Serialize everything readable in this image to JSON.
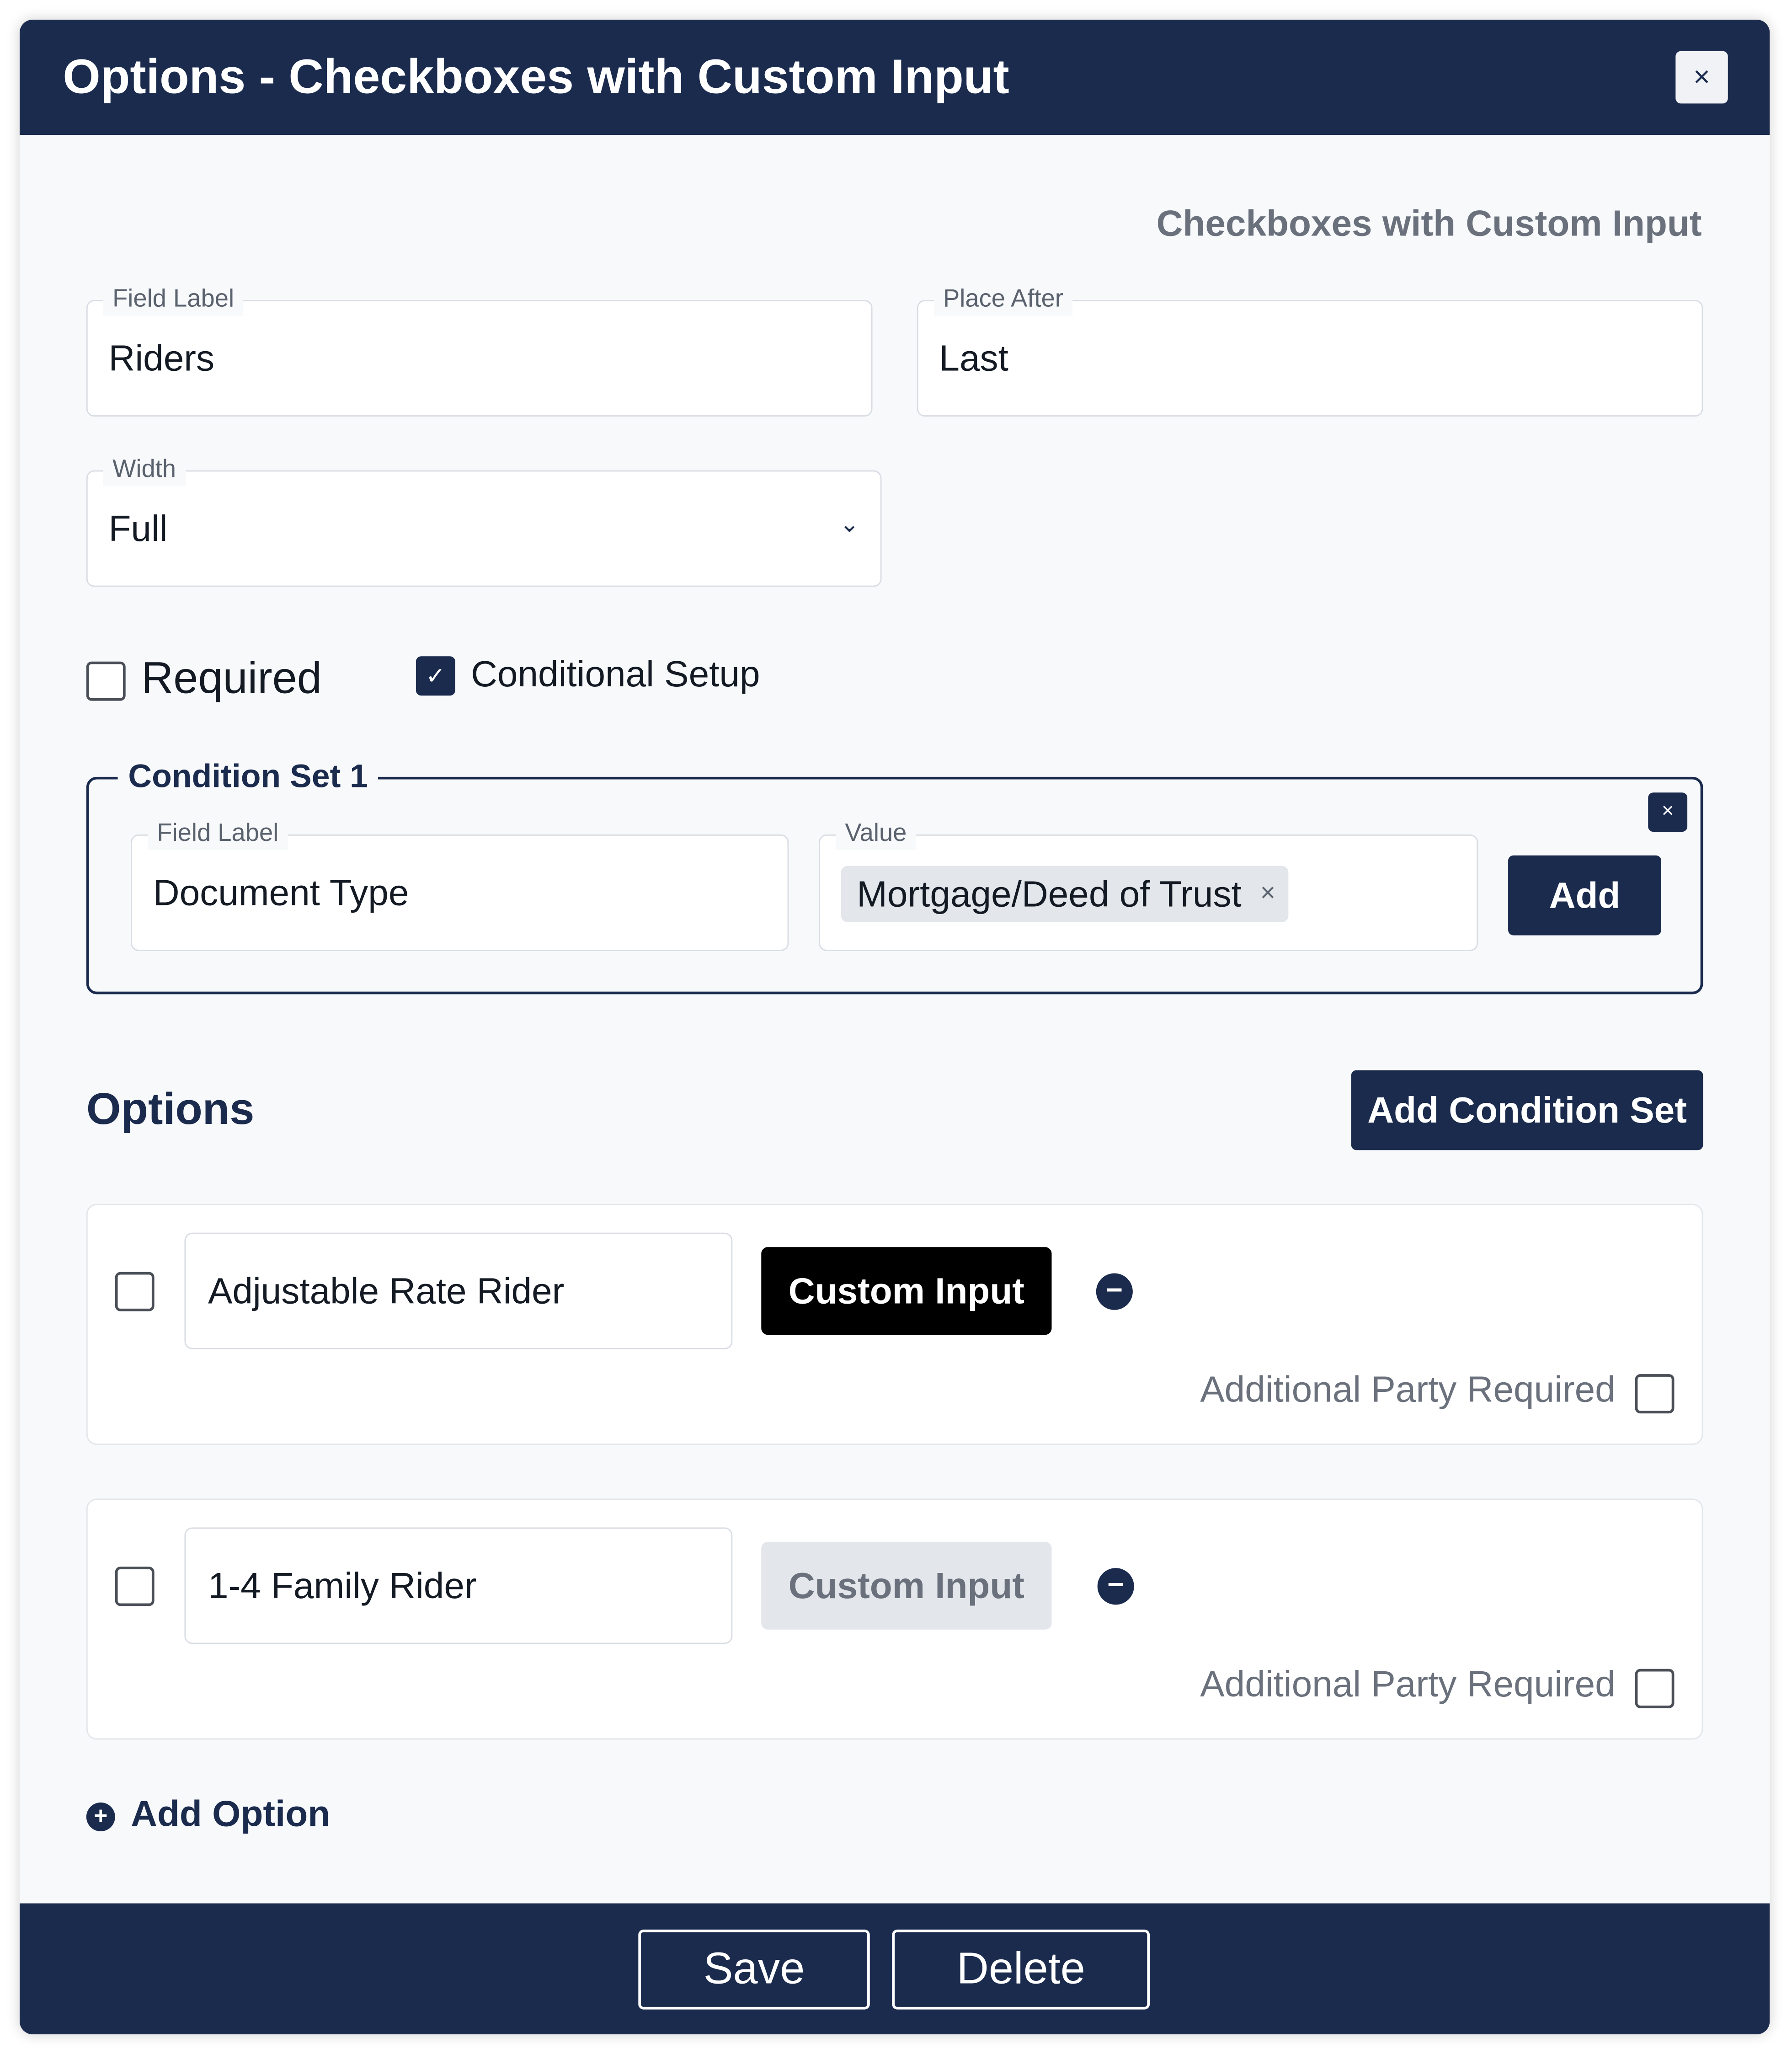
{
  "dialog": {
    "title": "Options - Checkboxes with Custom Input",
    "close_icon": "×",
    "type_label": "Checkboxes with Custom Input"
  },
  "form": {
    "field_label": {
      "legend": "Field Label",
      "value": "Riders"
    },
    "place_after": {
      "legend": "Place After",
      "value": "Last"
    },
    "width": {
      "legend": "Width",
      "value": "Full",
      "chevron": "⌄"
    },
    "required": {
      "label": "Required",
      "checked": false
    },
    "conditional_setup": {
      "label": "Conditional Setup",
      "checked": true,
      "check_glyph": "✓"
    }
  },
  "condition_set": {
    "title": "Condition Set 1",
    "close_icon": "×",
    "field_label": {
      "legend": "Field Label",
      "value": "Document Type"
    },
    "value": {
      "legend": "Value",
      "chip": "Mortgage/Deed of Trust",
      "chip_remove": "×"
    },
    "add_button": "Add"
  },
  "options": {
    "title": "Options",
    "add_condition_set": "Add Condition Set",
    "items": [
      {
        "checked": false,
        "name": "Adjustable Rate Rider",
        "custom_input": "Custom Input",
        "custom_input_active": true,
        "remove_icon": "−",
        "additional_party_label": "Additional Party Required",
        "additional_party_checked": false
      },
      {
        "checked": false,
        "name": "1-4 Family Rider",
        "custom_input": "Custom Input",
        "custom_input_active": false,
        "remove_icon": "−",
        "additional_party_label": "Additional Party Required",
        "additional_party_checked": false
      }
    ],
    "add_option": {
      "icon": "+",
      "label": "Add Option"
    }
  },
  "footer": {
    "save": "Save",
    "delete": "Delete"
  },
  "colors": {
    "primary": "#1b2b4e",
    "background": "#f8f9fb",
    "muted_text": "#6a717c",
    "custom_input_active": "#000000",
    "custom_input_inactive": "#e3e6ea"
  }
}
